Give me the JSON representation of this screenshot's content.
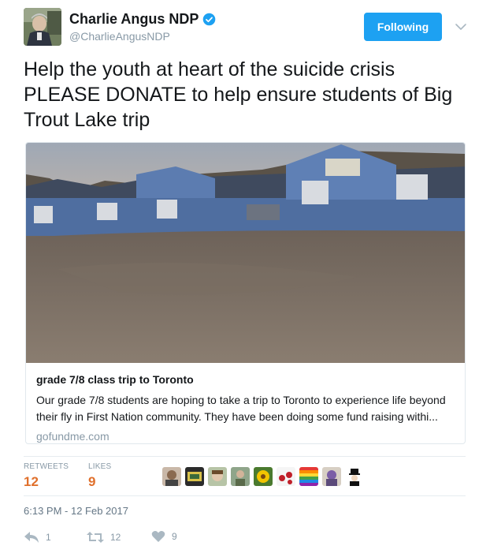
{
  "author": {
    "display_name": "Charlie Angus NDP",
    "handle": "@CharlieAngusNDP",
    "verified": true,
    "avatar_icon": "profile-photo"
  },
  "follow_button_label": "Following",
  "tweet_text": "Help the youth at heart of the suicide crisis\nPLEASE DONATE to help ensure students of  Big\nTrout Lake trip",
  "card": {
    "title": "grade 7/8 class trip to Toronto",
    "description": "Our grade 7/8 students are hoping to take a trip to Toronto to experience life beyond their fly in First Nation community. They have been doing some fund raising withi...",
    "domain": "gofundme.com",
    "image_icon": "school-building-photo"
  },
  "stats": {
    "retweets_label": "RETWEETS",
    "retweets_count": "12",
    "likes_label": "LIKES",
    "likes_count": "9",
    "likers_count": 9
  },
  "timestamp": "6:13 PM - 12 Feb 2017",
  "actions": {
    "reply_count": "1",
    "retweet_count": "12",
    "like_count": "9"
  },
  "colors": {
    "accent": "#1da1f2",
    "stat_value": "#e0702c",
    "muted": "#8899a6"
  }
}
